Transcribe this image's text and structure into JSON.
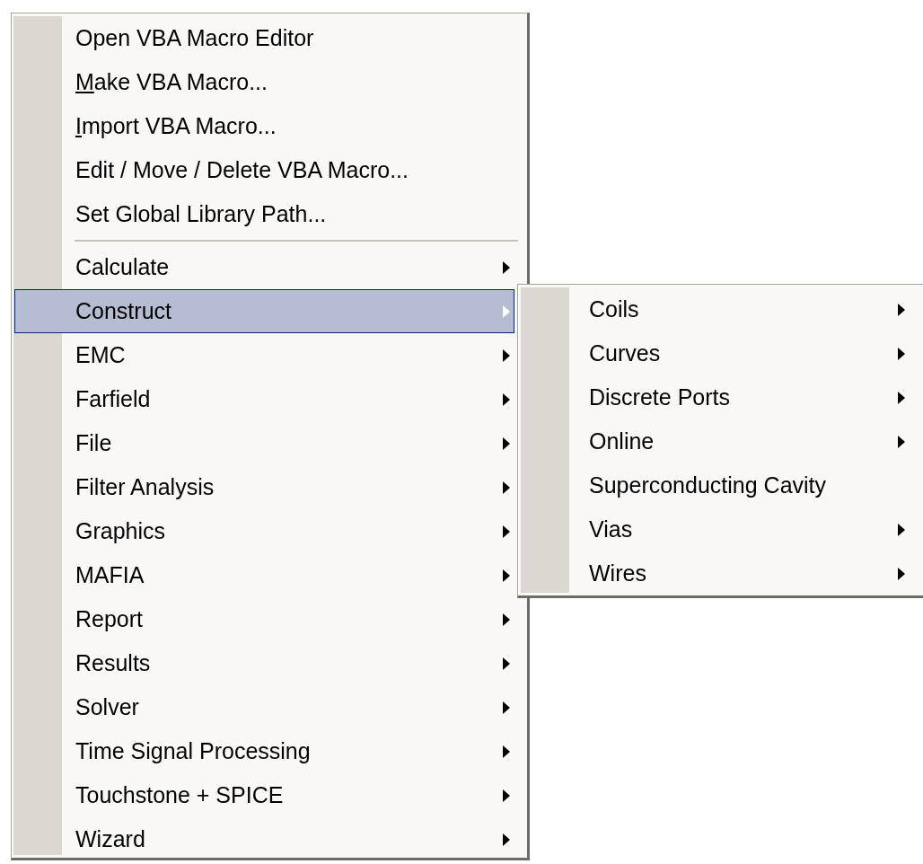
{
  "menu": {
    "items": [
      {
        "kind": "command",
        "label": "Open VBA Macro Editor",
        "underline_first": false,
        "selected": false
      },
      {
        "kind": "command",
        "label": "Make VBA Macro...",
        "underline_first": true,
        "selected": false
      },
      {
        "kind": "command",
        "label": "Import VBA Macro...",
        "underline_first": true,
        "selected": false
      },
      {
        "kind": "command",
        "label": "Edit / Move / Delete VBA Macro...",
        "underline_first": false,
        "selected": false
      },
      {
        "kind": "command",
        "label": "Set Global Library Path...",
        "underline_first": false,
        "selected": false
      },
      {
        "kind": "separator"
      },
      {
        "kind": "submenu",
        "label": "Calculate",
        "underline_first": false,
        "selected": false
      },
      {
        "kind": "submenu",
        "label": "Construct",
        "underline_first": false,
        "selected": true
      },
      {
        "kind": "submenu",
        "label": "EMC",
        "underline_first": false,
        "selected": false
      },
      {
        "kind": "submenu",
        "label": "Farfield",
        "underline_first": false,
        "selected": false
      },
      {
        "kind": "submenu",
        "label": "File",
        "underline_first": false,
        "selected": false
      },
      {
        "kind": "submenu",
        "label": "Filter Analysis",
        "underline_first": false,
        "selected": false
      },
      {
        "kind": "submenu",
        "label": "Graphics",
        "underline_first": false,
        "selected": false
      },
      {
        "kind": "submenu",
        "label": "MAFIA",
        "underline_first": false,
        "selected": false
      },
      {
        "kind": "submenu",
        "label": "Report",
        "underline_first": false,
        "selected": false
      },
      {
        "kind": "submenu",
        "label": "Results",
        "underline_first": false,
        "selected": false
      },
      {
        "kind": "submenu",
        "label": "Solver",
        "underline_first": false,
        "selected": false
      },
      {
        "kind": "submenu",
        "label": "Time Signal Processing",
        "underline_first": false,
        "selected": false
      },
      {
        "kind": "submenu",
        "label": "Touchstone + SPICE",
        "underline_first": false,
        "selected": false
      },
      {
        "kind": "submenu",
        "label": "Wizard",
        "underline_first": false,
        "selected": false
      }
    ]
  },
  "submenu": {
    "items": [
      {
        "kind": "submenu",
        "label": "Coils",
        "underline_first": false,
        "selected": false
      },
      {
        "kind": "submenu",
        "label": "Curves",
        "underline_first": false,
        "selected": false
      },
      {
        "kind": "submenu",
        "label": "Discrete Ports",
        "underline_first": false,
        "selected": false
      },
      {
        "kind": "submenu",
        "label": "Online",
        "underline_first": false,
        "selected": false
      },
      {
        "kind": "command",
        "label": "Superconducting Cavity",
        "underline_first": false,
        "selected": false
      },
      {
        "kind": "submenu",
        "label": "Vias",
        "underline_first": false,
        "selected": false
      },
      {
        "kind": "submenu",
        "label": "Wires",
        "underline_first": false,
        "selected": false
      }
    ]
  }
}
